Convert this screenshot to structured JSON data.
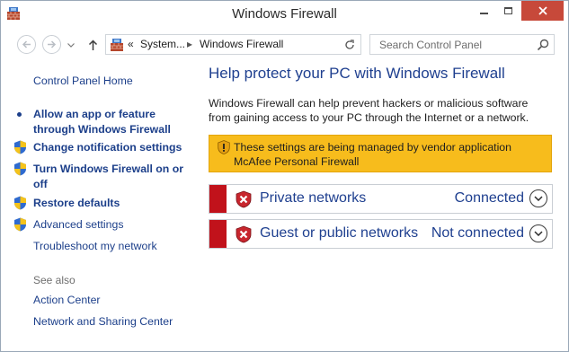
{
  "window": {
    "title": "Windows Firewall",
    "icon": "firewall-brick-icon"
  },
  "address": {
    "path_overflow": "«",
    "path_parent": "System...",
    "path_current": "Windows Firewall",
    "search_placeholder": "Search Control Panel"
  },
  "left_pane": {
    "home": "Control Panel Home",
    "links": [
      {
        "label": "Allow an app or feature through Windows Firewall",
        "icon": "bullet"
      },
      {
        "label": "Change notification settings",
        "icon": "shield-icon"
      },
      {
        "label": "Turn Windows Firewall on or off",
        "icon": "shield-icon"
      },
      {
        "label": "Restore defaults",
        "icon": "shield-icon"
      },
      {
        "label": "Advanced settings",
        "icon": "shield-icon"
      },
      {
        "label": "Troubleshoot my network",
        "icon": "none"
      }
    ],
    "see_also_heading": "See also",
    "see_also": [
      "Action Center",
      "Network and Sharing Center"
    ]
  },
  "main": {
    "title": "Help protect your PC with Windows Firewall",
    "description": "Windows Firewall can help prevent hackers or malicious software from gaining access to your PC through the Internet or a network.",
    "warning": "These settings are being managed by vendor application McAfee Personal Firewall",
    "networks": [
      {
        "name": "Private networks",
        "status": "Connected"
      },
      {
        "name": "Guest or public networks",
        "status": "Not connected"
      }
    ]
  },
  "colors": {
    "link": "#1c3f8a",
    "heading": "#1e3f8f",
    "warning_bg": "#f7bc1c",
    "network_strip": "#c1121b",
    "close_button": "#c7493a"
  }
}
